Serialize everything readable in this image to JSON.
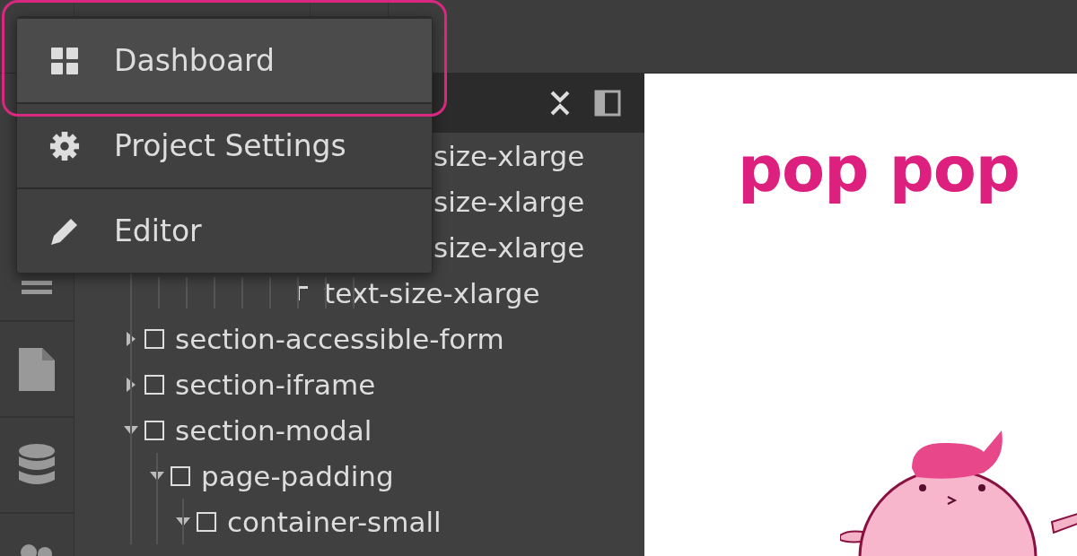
{
  "menu": {
    "items": [
      {
        "label": "Dashboard",
        "kind": "grid",
        "selected": true
      },
      {
        "label": "Project Settings",
        "kind": "gear",
        "selected": false
      },
      {
        "label": "Editor",
        "kind": "pencil",
        "selected": false
      }
    ]
  },
  "tree": {
    "deep_rows": [
      {
        "label": "size-xlarge",
        "kind": "plain"
      },
      {
        "label": "size-xlarge",
        "kind": "plain"
      },
      {
        "label": "size-xlarge",
        "kind": "plain"
      },
      {
        "label": "text-size-xlarge",
        "kind": "paragraph"
      }
    ],
    "items": [
      {
        "label": "section-accessible-form",
        "expanded": false
      },
      {
        "label": "section-iframe",
        "expanded": false
      },
      {
        "label": "section-modal",
        "expanded": true,
        "children": [
          {
            "label": "page-padding",
            "expanded": true,
            "children": [
              {
                "label": "container-small",
                "expanded": true
              }
            ]
          }
        ]
      }
    ]
  },
  "canvas": {
    "logo": "pop pop"
  }
}
